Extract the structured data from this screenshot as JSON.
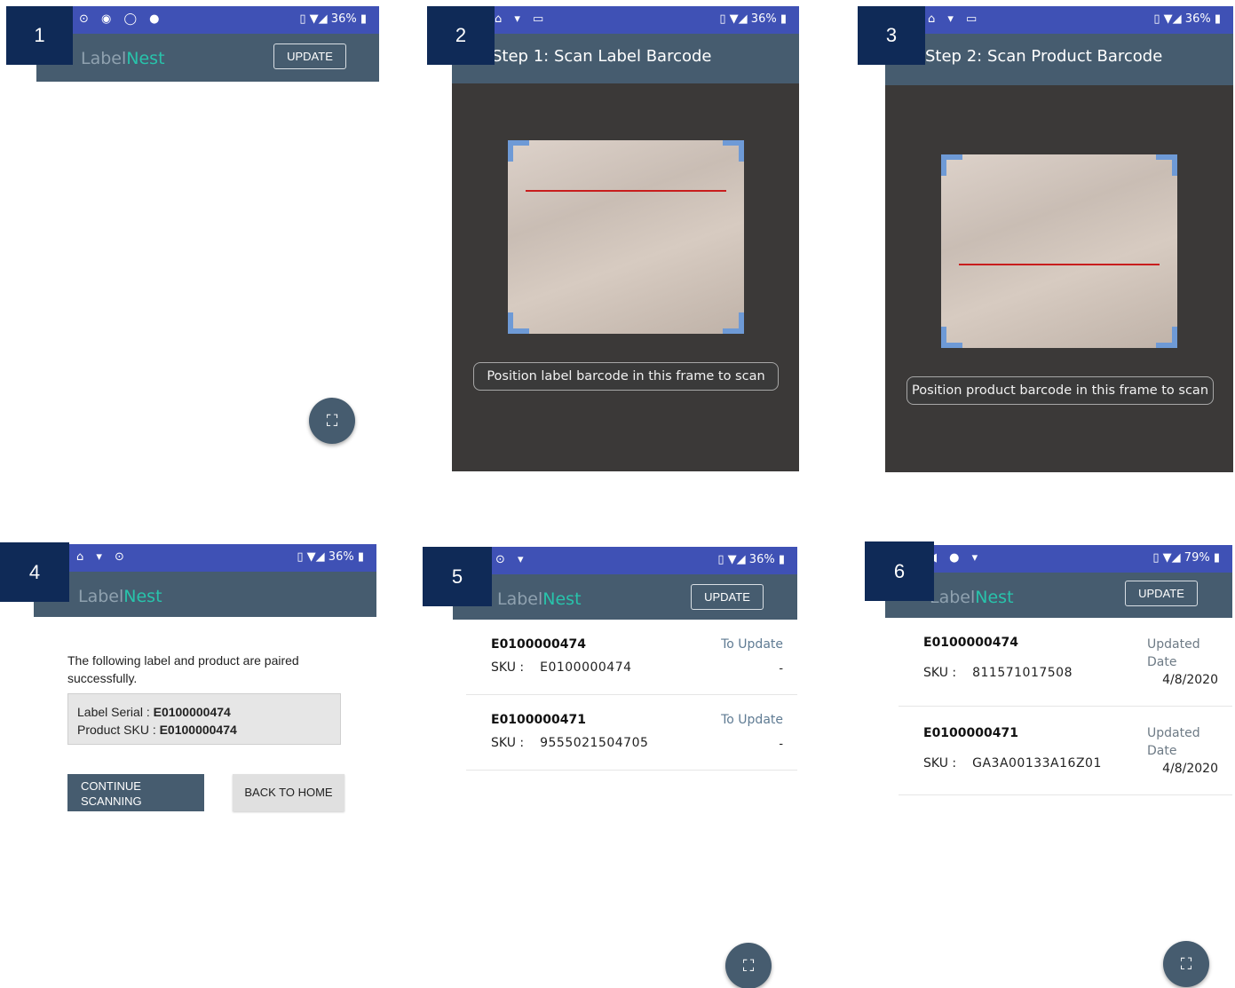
{
  "status_bar": {
    "battery_1": "36%",
    "battery_2": "36%",
    "battery_3": "36%",
    "battery_4": "36%",
    "battery_5": "36%",
    "battery_6": "79%"
  },
  "badges": [
    "1",
    "2",
    "3",
    "4",
    "5",
    "6"
  ],
  "app": {
    "logo_part1": "Label",
    "logo_part2": "Nest",
    "update_label": "UPDATE"
  },
  "screen2": {
    "title": "Step 1: Scan Label Barcode",
    "hint": "Position label barcode in this frame to scan"
  },
  "screen3": {
    "title": "Step 2: Scan Product Barcode",
    "hint": "Position product barcode in this frame to scan"
  },
  "screen4": {
    "message": "The following label and product are paired successfully.",
    "label_serial_caption": "Label Serial : ",
    "label_serial_value": "E0100000474",
    "product_sku_caption": "Product SKU : ",
    "product_sku_value": "E0100000474",
    "continue_label": "CONTINUE SCANNING",
    "home_label": "BACK TO HOME"
  },
  "screen5": {
    "rows": [
      {
        "serial": "E0100000474",
        "sku_caption": "SKU :",
        "sku": "E0100000474",
        "status": "To Update",
        "extra": "-"
      },
      {
        "serial": "E0100000471",
        "sku_caption": "SKU :",
        "sku": "9555021504705",
        "status": "To Update",
        "extra": "-"
      }
    ]
  },
  "screen6": {
    "rows": [
      {
        "serial": "E0100000474",
        "sku_caption": "SKU :",
        "sku": "811571017508",
        "status": "Updated Date",
        "date": "4/8/2020"
      },
      {
        "serial": "E0100000471",
        "sku_caption": "SKU :",
        "sku": "GA3A00133A16Z01",
        "status": "Updated Date",
        "date": "4/8/2020"
      }
    ]
  },
  "icons": {
    "scan_fab": "fullscreen-scan-icon",
    "status_icons": [
      "whatsapp-icon",
      "location-icon",
      "notification-icon",
      "wifi-icon",
      "signal-icon",
      "battery-icon",
      "vibrate-icon"
    ]
  },
  "colors": {
    "status_bar": "#3f51b5",
    "app_bar": "#465c6f",
    "badge": "#0f2a57",
    "logo_accent": "#28c3ab",
    "laser": "#c81d1d",
    "frame_corner": "#6e9ad6"
  }
}
